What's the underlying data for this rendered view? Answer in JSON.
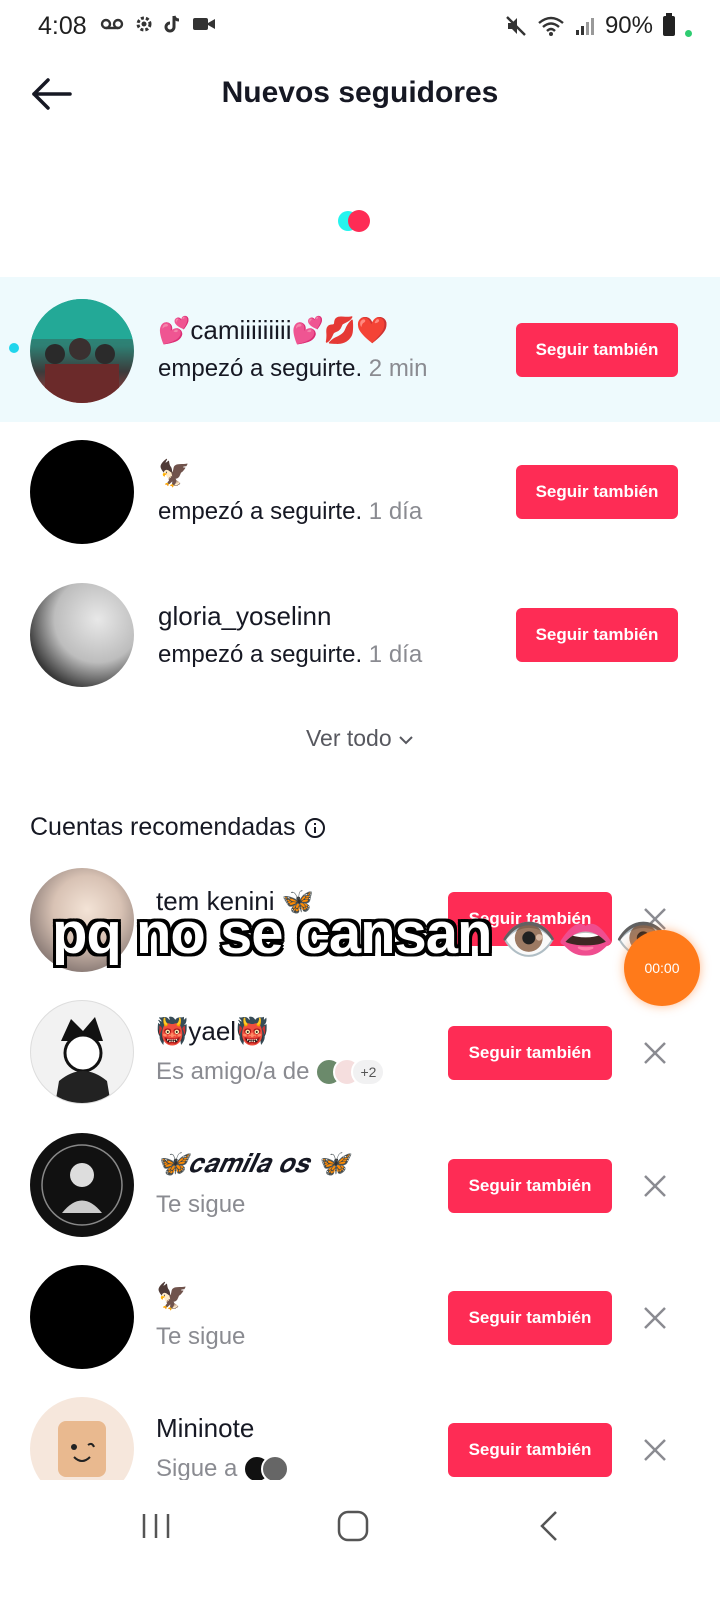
{
  "status_bar": {
    "time": "4:08",
    "icons_left": [
      "voicemail-icon",
      "settings-icon",
      "tiktok-icon",
      "video-icon"
    ],
    "battery": "90%",
    "icons_right": [
      "mute-icon",
      "wifi-icon",
      "signal-icon",
      "battery-icon"
    ]
  },
  "header": {
    "title": "Nuevos seguidores"
  },
  "followers": [
    {
      "name": "💕camiiiiiiiii💕💋❤️",
      "action": "empezó a seguirte.",
      "time": "2 min",
      "button": "Seguir también",
      "unread": true
    },
    {
      "name": "🦅",
      "action": "empezó a seguirte.",
      "time": "1 día",
      "button": "Seguir también",
      "unread": false
    },
    {
      "name": "gloria_yoselinn",
      "action": "empezó a seguirte.",
      "time": "1 día",
      "button": "Seguir también",
      "unread": false
    }
  ],
  "see_all": "Ver todo",
  "recommended": {
    "title": "Cuentas recomendadas",
    "items": [
      {
        "name": "tem kenini 🦋",
        "sub": "",
        "button": "Seguir también"
      },
      {
        "name": "👹yael👹",
        "sub": "Es amigo/a de",
        "extra": "+2",
        "button": "Seguir también"
      },
      {
        "name": "🦋𝒄𝒂𝒎𝒊𝒍𝒂 𝒐𝒔 🦋",
        "sub": "Te sigue",
        "button": "Seguir también"
      },
      {
        "name": "🦅",
        "sub": "Te sigue",
        "button": "Seguir también"
      },
      {
        "name": "Mininote",
        "sub": "Sigue a",
        "button": "Seguir también"
      }
    ]
  },
  "overlay": {
    "caption": "pq no se cansan",
    "emojis": "👁️👄👁️",
    "timer": "00:00"
  },
  "colors": {
    "accent": "#fe2c55",
    "highlight_row": "#eefafd",
    "unread_dot": "#20d5ec"
  }
}
